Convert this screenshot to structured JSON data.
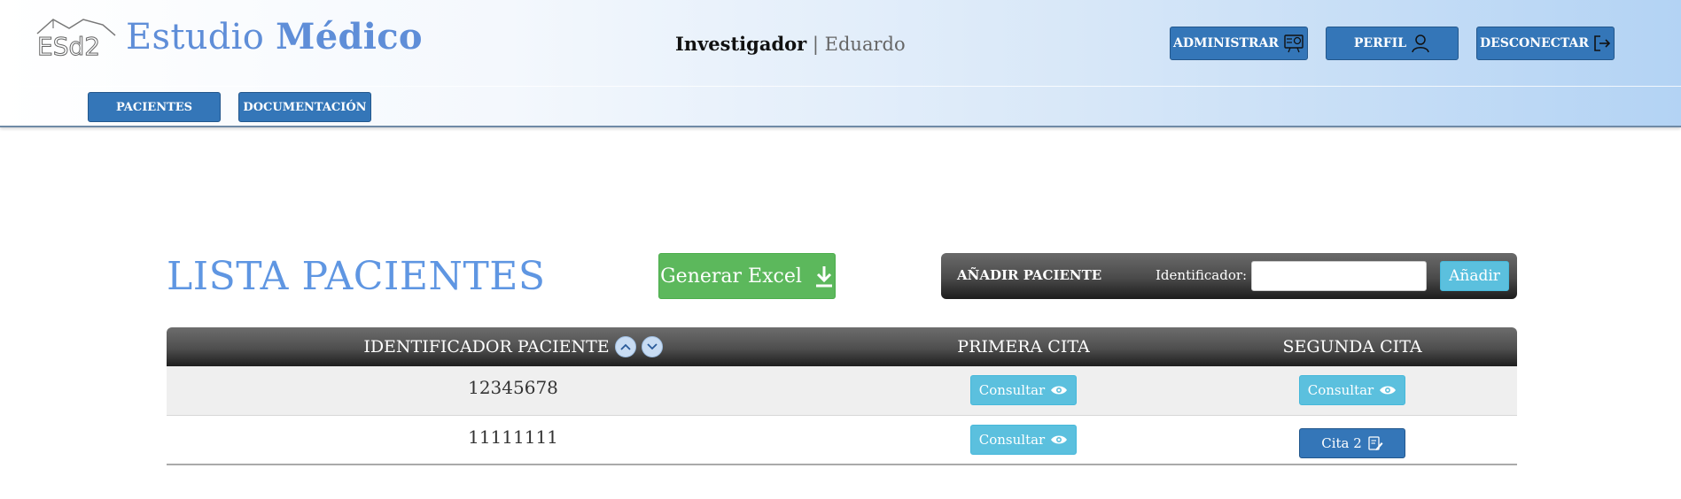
{
  "header": {
    "logo_text": "ESd2",
    "title_part1": "Estudio ",
    "title_part2": "Médico",
    "user_role": "Investigador",
    "separator": " | ",
    "user_name": "Eduardo",
    "buttons": {
      "admin": "ADMINISTRAR",
      "profile": "PERFIL",
      "logout": "DESCONECTAR"
    },
    "nav": {
      "patients": "PACIENTES",
      "documentation": "DOCUMENTACIÓN"
    },
    "icons": {
      "admin": "admin-panel-icon",
      "profile": "user-icon",
      "logout": "logout-icon"
    }
  },
  "main": {
    "title": "LISTA PACIENTES",
    "excel_button": "Generar Excel",
    "add_panel": {
      "label": "AÑADIR PACIENTE",
      "identifier_label": "Identificador:",
      "identifier_value": "",
      "add_button": "Añadir"
    }
  },
  "table": {
    "columns": [
      "IDENTIFICADOR PACIENTE",
      "PRIMERA CITA",
      "SEGUNDA CITA"
    ],
    "rows": [
      {
        "id": "12345678",
        "first": "Consultar",
        "second": "Consultar",
        "second_type": "consult"
      },
      {
        "id": "11111111",
        "first": "Consultar",
        "second": "Cita 2",
        "second_type": "appointment"
      }
    ]
  },
  "colors": {
    "primary_blue": "#3476b8",
    "info_cyan": "#5bc0de",
    "success_green": "#5cb85c",
    "title_blue": "#5f96e2"
  }
}
